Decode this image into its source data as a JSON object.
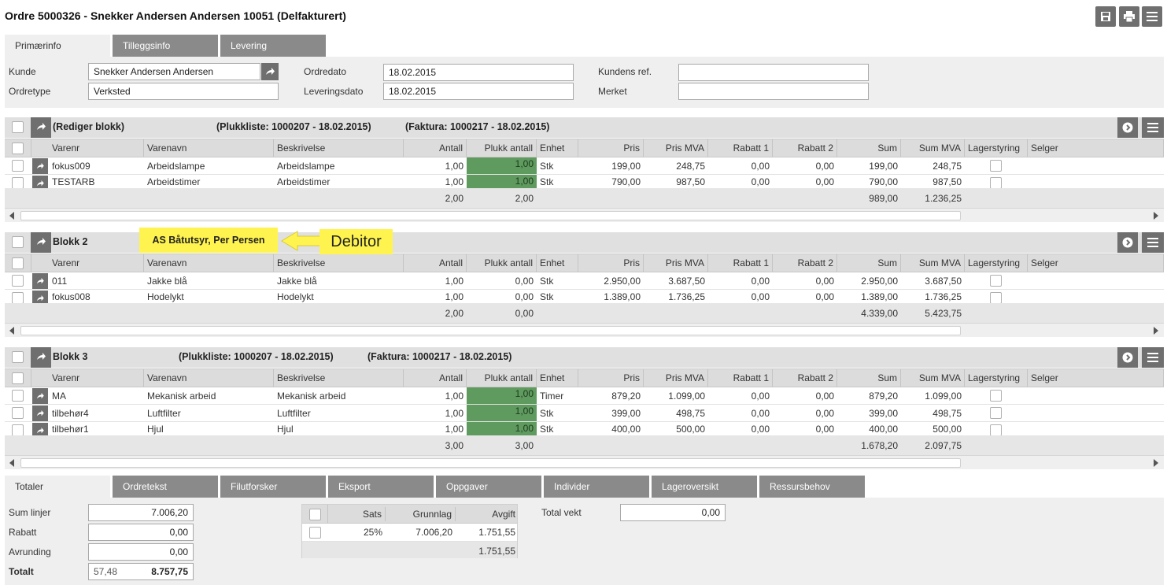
{
  "title": "Ordre 5000326 - Snekker Andersen Andersen 10051 (Delfakturert)",
  "toolbar": {
    "icons": [
      "save-icon",
      "print-icon",
      "menu-icon"
    ]
  },
  "top_tabs": [
    "Primærinfo",
    "Tilleggsinfo",
    "Levering"
  ],
  "primary": {
    "kunde_label": "Kunde",
    "kunde_value": "Snekker Andersen Andersen",
    "ordretype_label": "Ordretype",
    "ordretype_value": "Verksted",
    "ordredato_label": "Ordredato",
    "ordredato_value": "18.02.2015",
    "leveringsdato_label": "Leveringsdato",
    "leveringsdato_value": "18.02.2015",
    "kundens_ref_label": "Kundens ref.",
    "kundens_ref_value": "",
    "merket_label": "Merket",
    "merket_value": ""
  },
  "columns": [
    "Varenr",
    "Varenavn",
    "Beskrivelse",
    "Antall",
    "Plukk antall",
    "Enhet",
    "Pris",
    "Pris MVA",
    "Rabatt 1",
    "Rabatt 2",
    "Sum",
    "Sum MVA",
    "Lagerstyring",
    "Selger"
  ],
  "blocks": [
    {
      "name": "(Rediger blokk)",
      "plukkliste": "(Plukkliste: 1000207 - 18.02.2015)",
      "faktura": "(Faktura: 1000217 - 18.02.2015)",
      "rows": [
        {
          "varenr": "fokus009",
          "varenavn": "Arbeidslampe",
          "beskrivelse": "Arbeidslampe",
          "antall": "1,00",
          "plukk": "1,00",
          "enhet": "Stk",
          "pris": "199,00",
          "pris_mva": "248,75",
          "rabatt1": "0,00",
          "rabatt2": "0,00",
          "sum": "199,00",
          "sum_mva": "248,75"
        },
        {
          "varenr": "TESTARB",
          "varenavn": "Arbeidstimer",
          "beskrivelse": "Arbeidstimer",
          "antall": "1,00",
          "plukk": "1,00",
          "enhet": "Stk",
          "pris": "790,00",
          "pris_mva": "987,50",
          "rabatt1": "0,00",
          "rabatt2": "0,00",
          "sum": "790,00",
          "sum_mva": "987,50"
        }
      ],
      "totals": {
        "antall": "2,00",
        "plukk": "2,00",
        "sum": "989,00",
        "sum_mva": "1.236,25"
      }
    },
    {
      "name": "Blokk 2",
      "debitor": "AS Båtutsyr, Per Persen",
      "rows": [
        {
          "varenr": "011",
          "varenavn": "Jakke blå",
          "beskrivelse": "Jakke blå",
          "antall": "1,00",
          "plukk": "0,00",
          "enhet": "Stk",
          "pris": "2.950,00",
          "pris_mva": "3.687,50",
          "rabatt1": "0,00",
          "rabatt2": "0,00",
          "sum": "2.950,00",
          "sum_mva": "3.687,50"
        },
        {
          "varenr": "fokus008",
          "varenavn": "Hodelykt",
          "beskrivelse": "Hodelykt",
          "antall": "1,00",
          "plukk": "0,00",
          "enhet": "Stk",
          "pris": "1.389,00",
          "pris_mva": "1.736,25",
          "rabatt1": "0,00",
          "rabatt2": "0,00",
          "sum": "1.389,00",
          "sum_mva": "1.736,25"
        }
      ],
      "totals": {
        "antall": "2,00",
        "plukk": "0,00",
        "sum": "4.339,00",
        "sum_mva": "5.423,75"
      }
    },
    {
      "name": "Blokk 3",
      "plukkliste": "(Plukkliste: 1000207 - 18.02.2015)",
      "faktura": "(Faktura: 1000217 - 18.02.2015)",
      "rows": [
        {
          "varenr": "MA",
          "varenavn": "Mekanisk arbeid",
          "beskrivelse": "Mekanisk arbeid",
          "antall": "1,00",
          "plukk": "1,00",
          "enhet": "Timer",
          "pris": "879,20",
          "pris_mva": "1.099,00",
          "rabatt1": "0,00",
          "rabatt2": "0,00",
          "sum": "879,20",
          "sum_mva": "1.099,00"
        },
        {
          "varenr": "tilbehør4",
          "varenavn": "Luftfilter",
          "beskrivelse": "Luftfilter",
          "antall": "1,00",
          "plukk": "1,00",
          "enhet": "Stk",
          "pris": "399,00",
          "pris_mva": "498,75",
          "rabatt1": "0,00",
          "rabatt2": "0,00",
          "sum": "399,00",
          "sum_mva": "498,75"
        },
        {
          "varenr": "tilbehør1",
          "varenavn": "Hjul",
          "beskrivelse": "Hjul",
          "antall": "1,00",
          "plukk": "1,00",
          "enhet": "Stk",
          "pris": "400,00",
          "pris_mva": "500,00",
          "rabatt1": "0,00",
          "rabatt2": "0,00",
          "sum": "400,00",
          "sum_mva": "500,00"
        }
      ],
      "totals": {
        "antall": "3,00",
        "plukk": "3,00",
        "sum": "1.678,20",
        "sum_mva": "2.097,75"
      }
    }
  ],
  "annotation": {
    "label": "Debitor"
  },
  "bottom_tabs": [
    "Totaler",
    "Ordretekst",
    "Filutforsker",
    "Eksport",
    "Oppgaver",
    "Individer",
    "Lageroversikt",
    "Ressursbehov"
  ],
  "totals": {
    "sum_linjer_label": "Sum linjer",
    "sum_linjer_value": "7.006,20",
    "rabatt_label": "Rabatt",
    "rabatt_value": "0,00",
    "avrunding_label": "Avrunding",
    "avrunding_value": "0,00",
    "totalt_label": "Totalt",
    "totalt_small": "57,48",
    "totalt_value": "8.757,75",
    "total_vekt_label": "Total vekt",
    "total_vekt_value": "0,00"
  },
  "vat": {
    "headers": [
      "Sats",
      "Grunnlag",
      "Avgift"
    ],
    "row": {
      "sats": "25%",
      "grunnlag": "7.006,20",
      "avgift": "1.751,55"
    },
    "total": "1.751,55"
  },
  "colors": {
    "accent_green": "#5f9a5f",
    "highlight_yellow": "#fff44f",
    "button_gray": "#6f6f6f",
    "tab_gray": "#8a8a8a"
  }
}
